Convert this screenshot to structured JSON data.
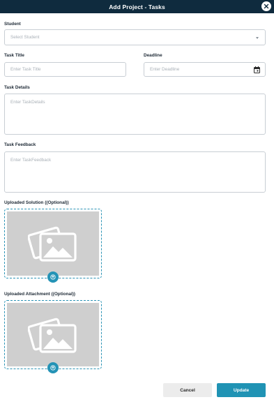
{
  "header": {
    "title": "Add Project - Tasks"
  },
  "student": {
    "label": "Student",
    "placeholder": "Select Student"
  },
  "task_title": {
    "label": "Task Title",
    "placeholder": "Enter Task Title"
  },
  "deadline": {
    "label": "Deadline",
    "placeholder": "Enter Deadline"
  },
  "task_details": {
    "label": "Task Details",
    "placeholder": "Enter TaskDetails"
  },
  "task_feedback": {
    "label": "Task Feedback",
    "placeholder": "Enter TaskFeedback"
  },
  "uploaded_solution": {
    "label": "Uploaded Solution ((Optional))"
  },
  "uploaded_attachment": {
    "label": "Uploaded Attachment ((Optional))"
  },
  "actions": {
    "cancel_label": "Cancel",
    "update_label": "Update"
  },
  "colors": {
    "header_bg": "#0f2b3e",
    "accent": "#2093b4",
    "placeholder_bg": "#cfcfcf"
  }
}
